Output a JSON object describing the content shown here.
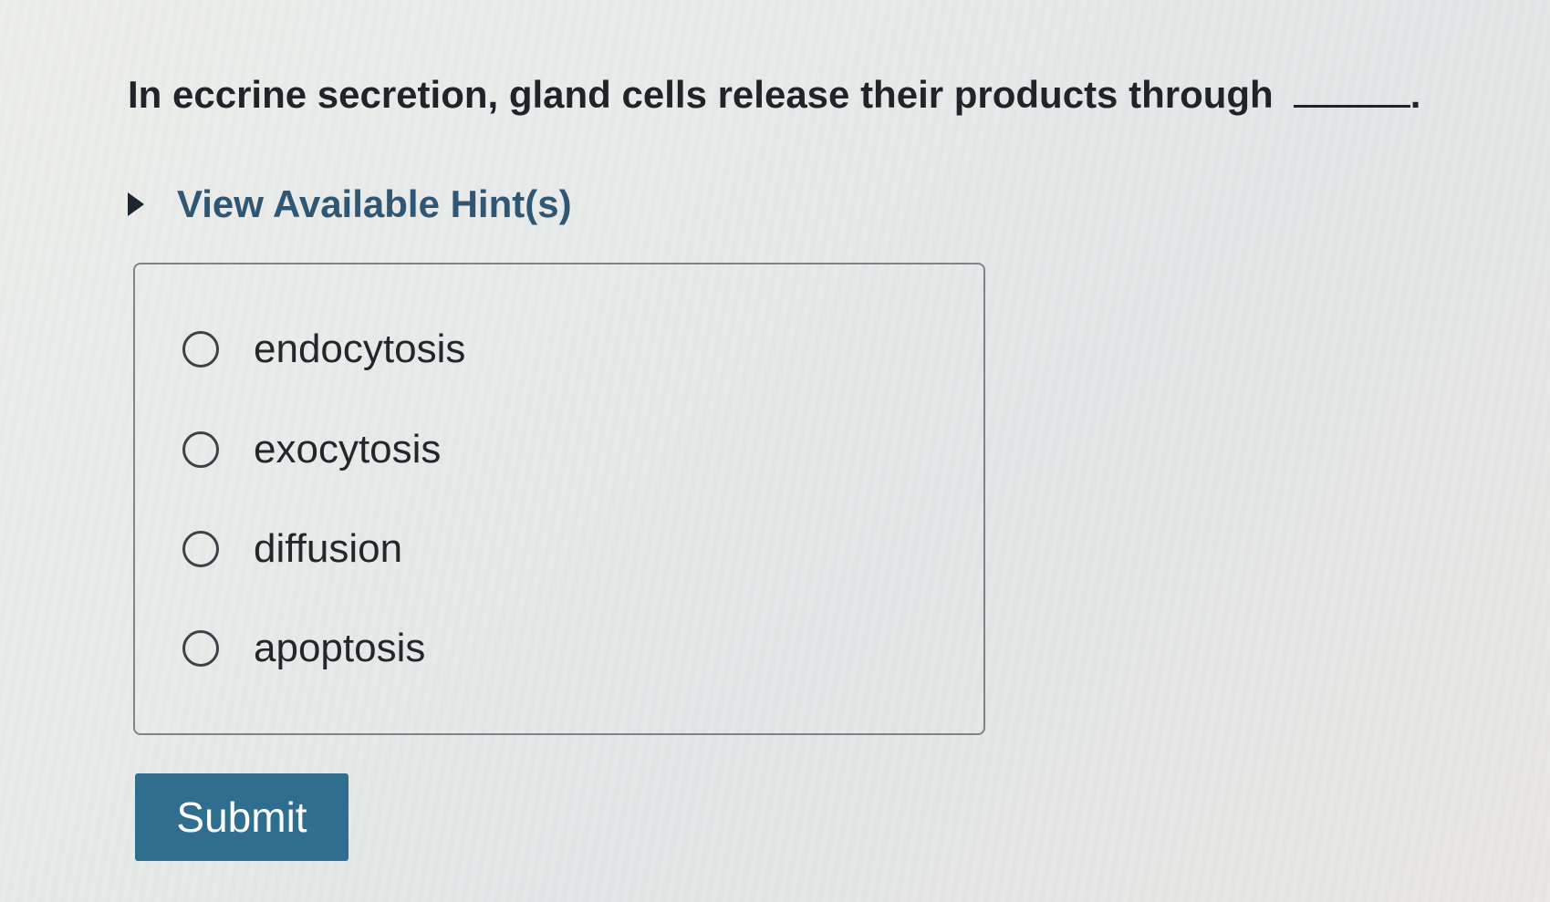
{
  "question": {
    "text": "In eccrine secretion, gland cells release their products through",
    "end_punct": "."
  },
  "hint": {
    "label": "View Available Hint(s)",
    "icon": "caret-right-icon"
  },
  "options": [
    {
      "label": "endocytosis",
      "selected": false
    },
    {
      "label": "exocytosis",
      "selected": false
    },
    {
      "label": "diffusion",
      "selected": false
    },
    {
      "label": "apoptosis",
      "selected": false
    }
  ],
  "submit": {
    "label": "Submit"
  },
  "colors": {
    "hint_text": "#2f5672",
    "submit_bg": "#2f6e8e",
    "question_text": "#1f2428"
  }
}
